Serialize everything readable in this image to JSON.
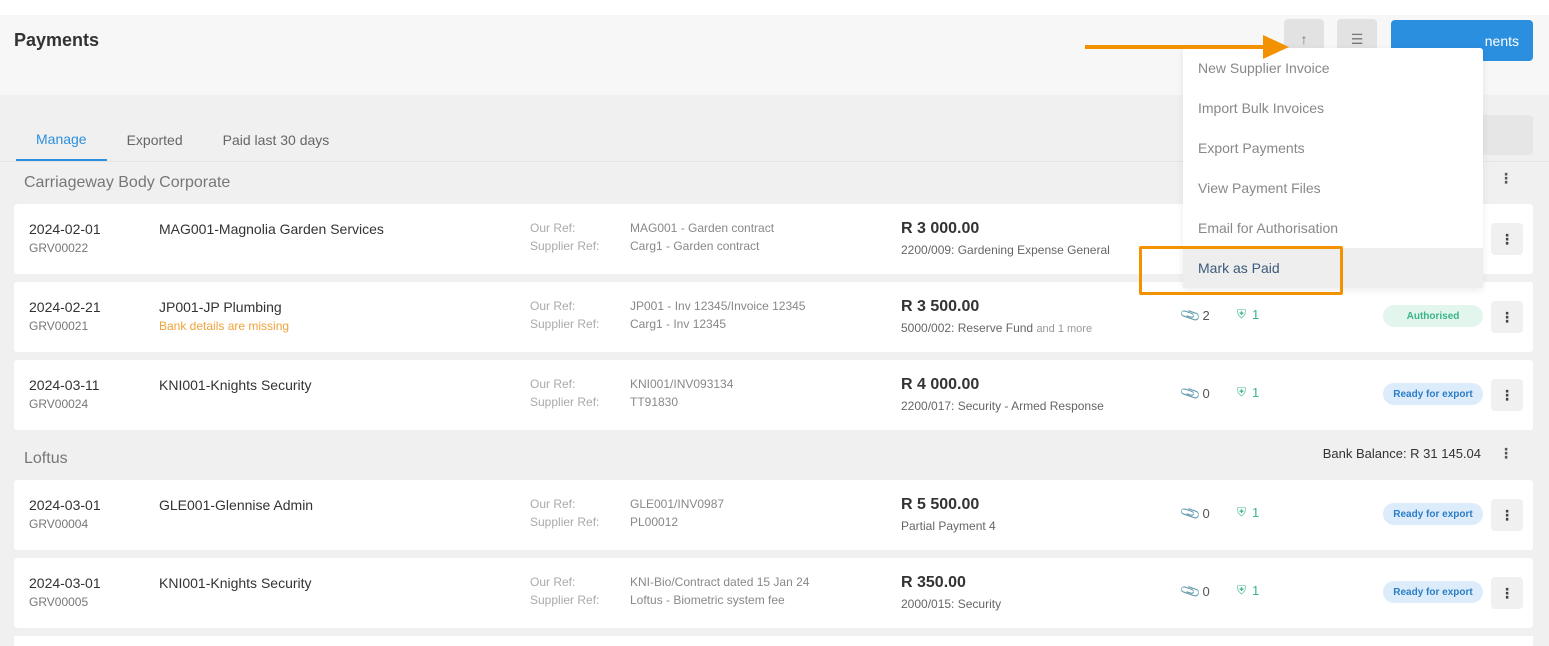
{
  "page": {
    "title": "Payments"
  },
  "header": {
    "primary_button": "nents",
    "icon_buttons": [
      "upload-icon",
      "filter-icon"
    ]
  },
  "tabs": [
    {
      "label": "Manage",
      "active": true
    },
    {
      "label": "Exported",
      "active": false
    },
    {
      "label": "Paid last 30 days",
      "active": false
    }
  ],
  "labels": {
    "our_ref": "Our Ref:",
    "supplier_ref": "Supplier Ref:"
  },
  "groups": [
    {
      "name": "Carriageway Body Corporate",
      "bank_balance": "",
      "rows": [
        {
          "date": "2024-02-01",
          "grv": "GRV00022",
          "supplier": "MAG001-Magnolia Garden Services",
          "warning": "",
          "our_ref": "MAG001 - Garden contract",
          "supplier_ref": "Carg1 - Garden contract",
          "amount": "R 3 000.00",
          "account": "2200/009: Gardening Expense General",
          "account_more": "",
          "attachments": "",
          "approvals": "",
          "status": ""
        },
        {
          "date": "2024-02-21",
          "grv": "GRV00021",
          "supplier": "JP001-JP Plumbing",
          "warning": "Bank details are missing",
          "our_ref": "JP001 - Inv 12345/Invoice 12345",
          "supplier_ref": "Carg1 - Inv 12345",
          "amount": "R 3 500.00",
          "account": "5000/002: Reserve Fund",
          "account_more": "and 1 more",
          "attachments": "2",
          "approvals": "1",
          "status": "Authorised"
        },
        {
          "date": "2024-03-11",
          "grv": "GRV00024",
          "supplier": "KNI001-Knights Security",
          "warning": "",
          "our_ref": "KNI001/INV093134",
          "supplier_ref": "TT91830",
          "amount": "R 4 000.00",
          "account": "2200/017: Security - Armed Response",
          "account_more": "",
          "attachments": "0",
          "approvals": "1",
          "status": "Ready for export"
        }
      ]
    },
    {
      "name": "Loftus",
      "bank_balance": "Bank Balance: R 31 145.04",
      "rows": [
        {
          "date": "2024-03-01",
          "grv": "GRV00004",
          "supplier": "GLE001-Glennise Admin",
          "warning": "",
          "our_ref": "GLE001/INV0987",
          "supplier_ref": "PL00012",
          "amount": "R 5 500.00",
          "account": "Partial Payment 4",
          "account_more": "",
          "attachments": "0",
          "approvals": "1",
          "status": "Ready for export"
        },
        {
          "date": "2024-03-01",
          "grv": "GRV00005",
          "supplier": "KNI001-Knights Security",
          "warning": "",
          "our_ref": "KNI-Bio/Contract dated 15 Jan 24",
          "supplier_ref": "Loftus - Biometric system fee",
          "amount": "R 350.00",
          "account": "2000/015: Security",
          "account_more": "",
          "attachments": "0",
          "approvals": "1",
          "status": "Ready for export"
        }
      ]
    }
  ],
  "dropdown": {
    "items": [
      "New Supplier Invoice",
      "Import Bulk Invoices",
      "Export Payments",
      "View Payment Files",
      "Email for Authorisation",
      "Mark as Paid"
    ],
    "selected": "Mark as Paid"
  },
  "colors": {
    "accent": "#2b8fe0",
    "highlight": "#f39200",
    "success": "#3bb389",
    "warning": "#f0a23a"
  }
}
